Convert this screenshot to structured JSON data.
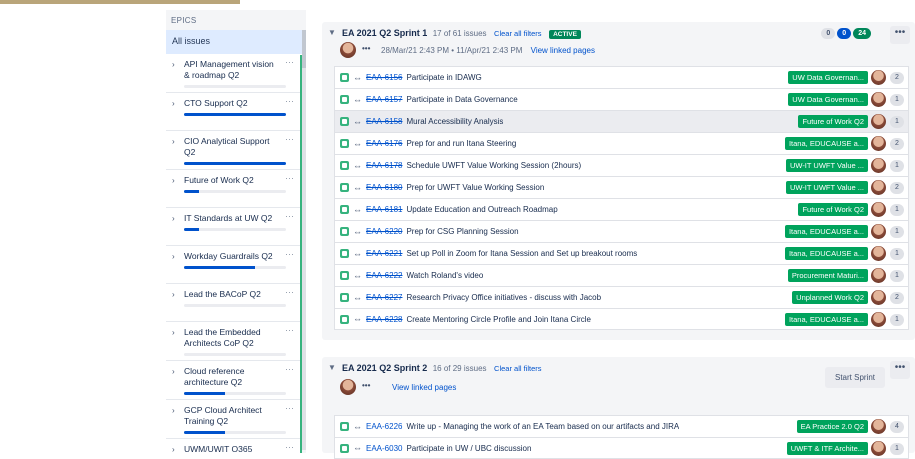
{
  "epics_panel": {
    "heading": "EPICS",
    "all_issues": "All issues",
    "items": [
      {
        "label": "API Management vision & roadmap Q2",
        "progress": 0.0
      },
      {
        "label": "CTO Support Q2",
        "progress": 1.0
      },
      {
        "label": "CIO Analytical Support Q2",
        "progress": 1.0
      },
      {
        "label": "Future of Work Q2",
        "progress": 0.15
      },
      {
        "label": "IT Standards at UW Q2",
        "progress": 0.15
      },
      {
        "label": "Workday Guardrails Q2",
        "progress": 0.7
      },
      {
        "label": "Lead the BACoP Q2",
        "progress": 0.0
      },
      {
        "label": "Lead the Embedded Architects CoP Q2",
        "progress": 0.0
      },
      {
        "label": "Cloud reference architecture Q2",
        "progress": 0.4
      },
      {
        "label": "GCP Cloud Architect Training Q2",
        "progress": 0.4
      },
      {
        "label": "UWM/UWIT O365",
        "progress": 0.0
      }
    ]
  },
  "sprint1": {
    "title": "EA 2021 Q2 Sprint 1",
    "count": "17 of 61 issues",
    "clear": "Clear all filters",
    "badge": "ACTIVE",
    "pills": [
      "0",
      "0",
      "24"
    ],
    "more": "•••",
    "dots": "•••",
    "dates": "28/Mar/21 2:43 PM • 11/Apr/21 2:43 PM",
    "linked": "View linked pages",
    "issues": [
      {
        "key": "EAA-6156",
        "summary": "Participate in IDAWG",
        "epic": "UW Data Governan...",
        "points": "2",
        "done": true
      },
      {
        "key": "EAA-6157",
        "summary": "Participate in Data Governance",
        "epic": "UW Data Governan...",
        "points": "1",
        "done": true
      },
      {
        "key": "EAA-6158",
        "summary": "Mural Accessibility Analysis",
        "epic": "Future of Work Q2",
        "points": "1",
        "done": true
      },
      {
        "key": "EAA-6176",
        "summary": "Prep for and run Itana Steering",
        "epic": "Itana, EDUCAUSE a...",
        "points": "2",
        "done": true
      },
      {
        "key": "EAA-6178",
        "summary": "Schedule UWFT Value Working Session (2hours)",
        "epic": "UW-IT UWFT Value ...",
        "points": "1",
        "done": true
      },
      {
        "key": "EAA-6180",
        "summary": "Prep for UWFT Value Working Session",
        "epic": "UW-IT UWFT Value ...",
        "points": "2",
        "done": true
      },
      {
        "key": "EAA-6181",
        "summary": "Update Education and Outreach Roadmap",
        "epic": "Future of Work Q2",
        "points": "1",
        "done": true
      },
      {
        "key": "EAA-6220",
        "summary": "Prep for CSG Planning Session",
        "epic": "Itana, EDUCAUSE a...",
        "points": "1",
        "done": true
      },
      {
        "key": "EAA-6221",
        "summary": "Set up Poll in Zoom for Itana Session and Set up breakout rooms",
        "epic": "Itana, EDUCAUSE a...",
        "points": "1",
        "done": true
      },
      {
        "key": "EAA-6222",
        "summary": "Watch Roland's video",
        "epic": "Procurement Maturi...",
        "points": "1",
        "done": true
      },
      {
        "key": "EAA-6227",
        "summary": "Research Privacy Office initiatives - discuss with Jacob",
        "epic": "Unplanned Work Q2",
        "points": "2",
        "done": true
      },
      {
        "key": "EAA-6228",
        "summary": "Create Mentoring Circle Profile and Join Itana Circle",
        "epic": "Itana, EDUCAUSE a...",
        "points": "1",
        "done": true
      }
    ]
  },
  "sprint2": {
    "title": "EA 2021 Q2 Sprint 2",
    "count": "16 of 29 issues",
    "clear": "Clear all filters",
    "start": "Start Sprint",
    "more": "•••",
    "dots": "•••",
    "linked": "View linked pages",
    "issues": [
      {
        "key": "EAA-6226",
        "summary": "Write up - Managing the work of an EA Team based on our artifacts and JIRA",
        "epic": "EA Practice 2.0 Q2",
        "points": "4",
        "done": false
      },
      {
        "key": "EAA-6030",
        "summary": "Participate in UW / UBC discussion",
        "epic": "UWFT & ITF Archite...",
        "points": "1",
        "done": false
      }
    ]
  }
}
